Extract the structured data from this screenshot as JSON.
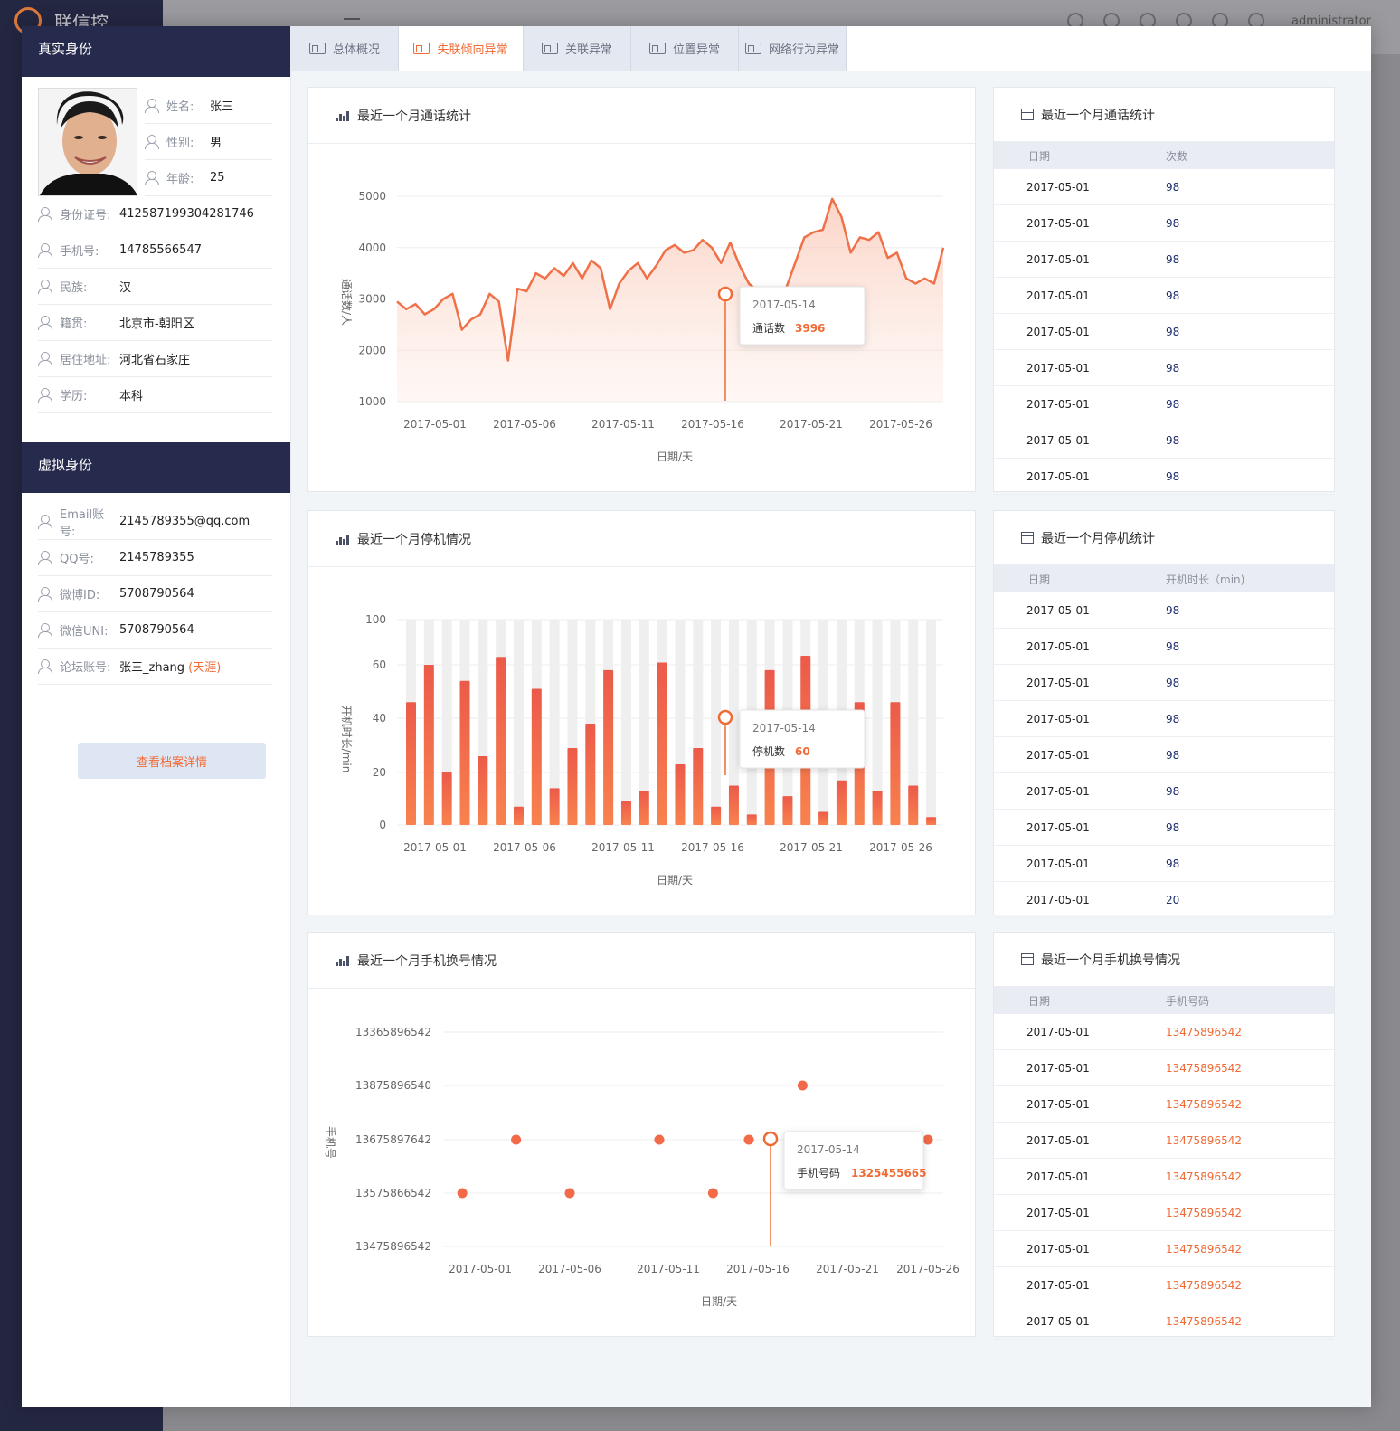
{
  "app": {
    "title": "联信控",
    "user": "administrator"
  },
  "tabs": [
    {
      "label": "总体概况",
      "active": false
    },
    {
      "label": "失联倾向异常",
      "active": true
    },
    {
      "label": "关联异常",
      "active": false
    },
    {
      "label": "位置异常",
      "active": false
    },
    {
      "label": "网络行为异常",
      "active": false
    }
  ],
  "real_identity": {
    "title": "真实身份",
    "name_label": "姓名:",
    "name": "张三",
    "gender_label": "性别:",
    "gender": "男",
    "age_label": "年龄:",
    "age": "25",
    "rows": [
      {
        "label": "身份证号:",
        "value": "412587199304281746"
      },
      {
        "label": "手机号:",
        "value": "14785566547"
      },
      {
        "label": "民族:",
        "value": "汉"
      },
      {
        "label": "籍贯:",
        "value": "北京市-朝阳区"
      },
      {
        "label": "居住地址:",
        "value": "河北省石家庄"
      },
      {
        "label": "学历:",
        "value": "本科"
      }
    ]
  },
  "virtual_identity": {
    "title": "虚拟身份",
    "rows": [
      {
        "label": "Email账号:",
        "value": "2145789355@qq.com"
      },
      {
        "label": "QQ号:",
        "value": "2145789355"
      },
      {
        "label": "微博ID:",
        "value": "5708790564"
      },
      {
        "label": "微信UNI:",
        "value": "5708790564"
      },
      {
        "label": "论坛账号:",
        "value": "张三_zhang",
        "extra": "(天涯)"
      }
    ],
    "detail_button": "查看档案详情"
  },
  "panels": {
    "calls_chart": {
      "title": "最近一个月通话统计"
    },
    "calls_table": {
      "title": "最近一个月通话统计",
      "col1": "日期",
      "col2": "次数"
    },
    "shutdown_chart": {
      "title": "最近一个月停机情况"
    },
    "shutdown_table": {
      "title": "最近一个月停机统计",
      "col1": "日期",
      "col2": "开机时长（min)"
    },
    "phone_chart": {
      "title": "最近一个月手机换号情况"
    },
    "phone_table": {
      "title": "最近一个月手机换号情况",
      "col1": "日期",
      "col2": "手机号码"
    }
  },
  "tables": {
    "calls": [
      [
        "2017-05-01",
        "98"
      ],
      [
        "2017-05-01",
        "98"
      ],
      [
        "2017-05-01",
        "98"
      ],
      [
        "2017-05-01",
        "98"
      ],
      [
        "2017-05-01",
        "98"
      ],
      [
        "2017-05-01",
        "98"
      ],
      [
        "2017-05-01",
        "98"
      ],
      [
        "2017-05-01",
        "98"
      ],
      [
        "2017-05-01",
        "98"
      ]
    ],
    "shutdown": [
      [
        "2017-05-01",
        "98"
      ],
      [
        "2017-05-01",
        "98"
      ],
      [
        "2017-05-01",
        "98"
      ],
      [
        "2017-05-01",
        "98"
      ],
      [
        "2017-05-01",
        "98"
      ],
      [
        "2017-05-01",
        "98"
      ],
      [
        "2017-05-01",
        "98"
      ],
      [
        "2017-05-01",
        "98"
      ],
      [
        "2017-05-01",
        "20"
      ]
    ],
    "phone": [
      [
        "2017-05-01",
        "13475896542"
      ],
      [
        "2017-05-01",
        "13475896542"
      ],
      [
        "2017-05-01",
        "13475896542"
      ],
      [
        "2017-05-01",
        "13475896542"
      ],
      [
        "2017-05-01",
        "13475896542"
      ],
      [
        "2017-05-01",
        "13475896542"
      ],
      [
        "2017-05-01",
        "13475896542"
      ],
      [
        "2017-05-01",
        "13475896542"
      ],
      [
        "2017-05-01",
        "13475896542"
      ]
    ]
  },
  "colors": {
    "accent": "#f06a35",
    "navy": "#262b4d",
    "bar": "#f06a48",
    "bar_bg": "#efefef"
  },
  "chart_data": [
    {
      "type": "area",
      "title": "最近一个月通话统计",
      "ylabel": "通话数/人",
      "xlabel": "日期/天",
      "ylim": [
        1000,
        5000
      ],
      "yticks": [
        5000,
        4000,
        3000,
        2000,
        1000
      ],
      "xtick_labels": [
        "2017-05-01",
        "2017-05-06",
        "2017-05-11",
        "2017-05-16",
        "2017-05-21",
        "2017-05-26"
      ],
      "values": [
        2950,
        2800,
        2900,
        2700,
        2800,
        3000,
        3100,
        2400,
        2600,
        2700,
        3100,
        2950,
        1800,
        3200,
        3150,
        3500,
        3400,
        3600,
        3450,
        3700,
        3400,
        3750,
        3600,
        2800,
        3300,
        3550,
        3700,
        3400,
        3650,
        3950,
        4050,
        3900,
        3950,
        4150,
        4000,
        3700,
        4100,
        3650,
        3300,
        3150,
        2750,
        2950,
        3200,
        3700,
        4200,
        4300,
        4350,
        4950,
        4600,
        3900,
        4200,
        4150,
        4300,
        3800,
        3900,
        3400,
        3300,
        3400,
        3300,
        4000
      ],
      "tooltip": {
        "date": "2017-05-14",
        "label": "通话数",
        "value": "3996"
      }
    },
    {
      "type": "bar",
      "title": "最近一个月停机情况",
      "ylabel": "开机时长/min",
      "xlabel": "日期/天",
      "ylim": [
        0,
        100
      ],
      "yticks": [
        100,
        60,
        40,
        20,
        0
      ],
      "xtick_labels": [
        "2017-05-01",
        "2017-05-06",
        "2017-05-11",
        "2017-05-16",
        "2017-05-21",
        "2017-05-26"
      ],
      "values": [
        46,
        60,
        20,
        54,
        26,
        67,
        7,
        51,
        14,
        29,
        38,
        58,
        9,
        13,
        62,
        23,
        29,
        7,
        15,
        4,
        58,
        11,
        68,
        5,
        17,
        46,
        13,
        46,
        15,
        3
      ],
      "tooltip": {
        "date": "2017-05-14",
        "label": "停机数",
        "value": "60"
      }
    },
    {
      "type": "scatter",
      "title": "最近一个月手机换号情况",
      "ylabel": "手机号",
      "xlabel": "日期/天",
      "ytick_labels": [
        "13365896542",
        "13875896540",
        "13675897642",
        "13575866542",
        "13475896542"
      ],
      "xtick_labels": [
        "2017-05-01",
        "2017-05-06",
        "2017-05-11",
        "2017-05-16",
        "2017-05-21",
        "2017-05-26"
      ],
      "points": [
        {
          "x": "2017-04-30",
          "y": "13575866542"
        },
        {
          "x": "2017-05-03",
          "y": "13675897642"
        },
        {
          "x": "2017-05-06",
          "y": "13575866542"
        },
        {
          "x": "2017-05-11",
          "y": "13675897642"
        },
        {
          "x": "2017-05-14",
          "y": "13575866542"
        },
        {
          "x": "2017-05-16",
          "y": "13675897642"
        },
        {
          "x": "2017-05-19",
          "y": "13875896540"
        },
        {
          "x": "2017-05-26",
          "y": "13675897642"
        }
      ],
      "tooltip": {
        "date": "2017-05-14",
        "label": "手机号码",
        "value": "1325455665"
      }
    }
  ]
}
